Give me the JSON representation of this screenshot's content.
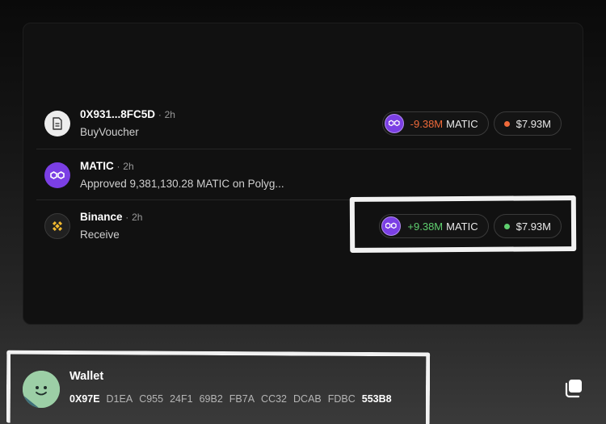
{
  "activity": [
    {
      "title": "0X931...8FC5D",
      "time": "2h",
      "subtitle": "BuyVoucher",
      "icon": "document-icon",
      "token_amount": "-9.38M",
      "token_symbol": "MATIC",
      "usd_value": "$7.93M",
      "status_color": "#f06a3a"
    },
    {
      "title": "MATIC",
      "time": "2h",
      "subtitle": "Approved 9,381,130.28 MATIC on Polyg...",
      "icon": "polygon-icon"
    },
    {
      "title": "Binance",
      "time": "2h",
      "subtitle": "Receive",
      "icon": "binance-icon",
      "token_amount": "+9.38M",
      "token_symbol": "MATIC",
      "usd_value": "$7.93M",
      "status_color": "#5fcf6f"
    }
  ],
  "separator": "·",
  "wallet": {
    "title": "Wallet",
    "address_parts": [
      "0X97E",
      "D1EA",
      "C955",
      "24F1",
      "69B2",
      "FB7A",
      "CC32",
      "DCAB",
      "FDBC",
      "553B8"
    ]
  },
  "colors": {
    "negative": "#ef6a3a",
    "positive": "#5fcf6f",
    "polygon": "#7b3fe4",
    "binance": "#f3ba2f"
  }
}
